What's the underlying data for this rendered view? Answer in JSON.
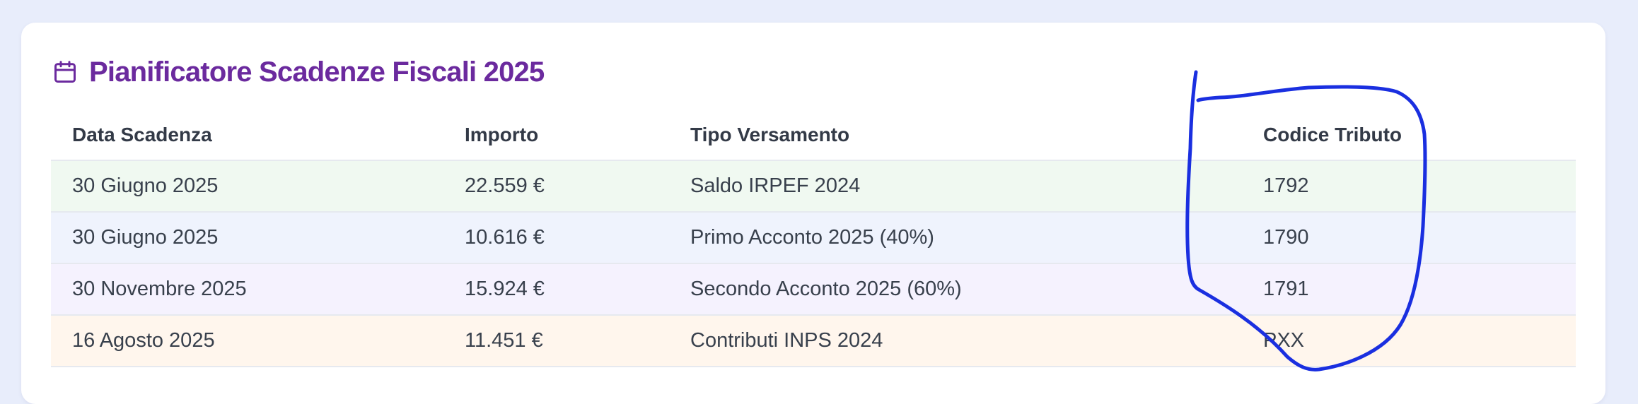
{
  "card": {
    "title": "Pianificatore Scadenze Fiscali 2025",
    "title_icon": "calendar-icon",
    "title_color": "#6b2a9e"
  },
  "table": {
    "headers": {
      "date": "Data Scadenza",
      "amount": "Importo",
      "type": "Tipo Versamento",
      "code": "Codice Tributo"
    },
    "rows": [
      {
        "date": "30 Giugno 2025",
        "amount": "22.559 €",
        "type": "Saldo IRPEF 2024",
        "code": "1792",
        "row_color": "#f0f9f1",
        "amount_color": "#3f9a50"
      },
      {
        "date": "30 Giugno 2025",
        "amount": "10.616 €",
        "type": "Primo Acconto 2025 (40%)",
        "code": "1790",
        "row_color": "#eff3fd",
        "amount_color": "#2c5fd6"
      },
      {
        "date": "30 Novembre 2025",
        "amount": "15.924 €",
        "type": "Secondo Acconto 2025 (60%)",
        "code": "1791",
        "row_color": "#f5f2fe",
        "amount_color": "#8a34d4"
      },
      {
        "date": "16 Agosto 2025",
        "amount": "11.451 €",
        "type": "Contributi INPS 2024",
        "code": "PXX",
        "row_color": "#fff6ed",
        "amount_color": "#d9591d"
      }
    ]
  },
  "annotation": {
    "color": "#1a2fe0",
    "shape": "hand-drawn circle around Codice Tributo column"
  }
}
